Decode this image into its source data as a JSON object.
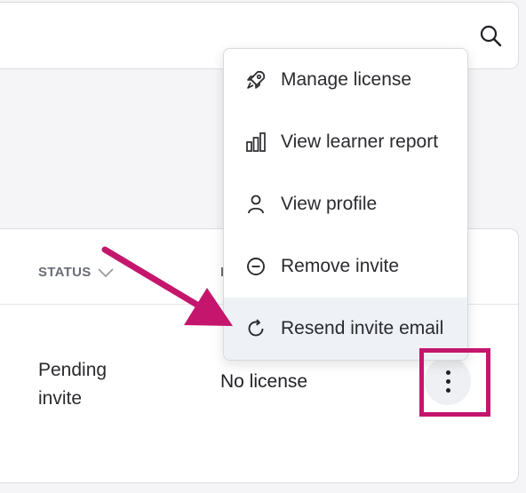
{
  "table": {
    "status_header": "STATUS",
    "license_header": "L",
    "row": {
      "status": "Pending invite",
      "license": "No license"
    }
  },
  "menu": {
    "items": [
      {
        "label": "Manage license",
        "icon": "rocket-icon"
      },
      {
        "label": "View learner report",
        "icon": "bar-chart-icon"
      },
      {
        "label": "View profile",
        "icon": "person-icon"
      },
      {
        "label": "Remove invite",
        "icon": "minus-circle-icon"
      },
      {
        "label": "Resend invite email",
        "icon": "refresh-icon"
      }
    ],
    "highlighted_item": "Resend invite email"
  },
  "colors": {
    "annotation": "#c4166d",
    "page_bg": "#f5f5f7",
    "hover_bg": "#eef1f5"
  }
}
